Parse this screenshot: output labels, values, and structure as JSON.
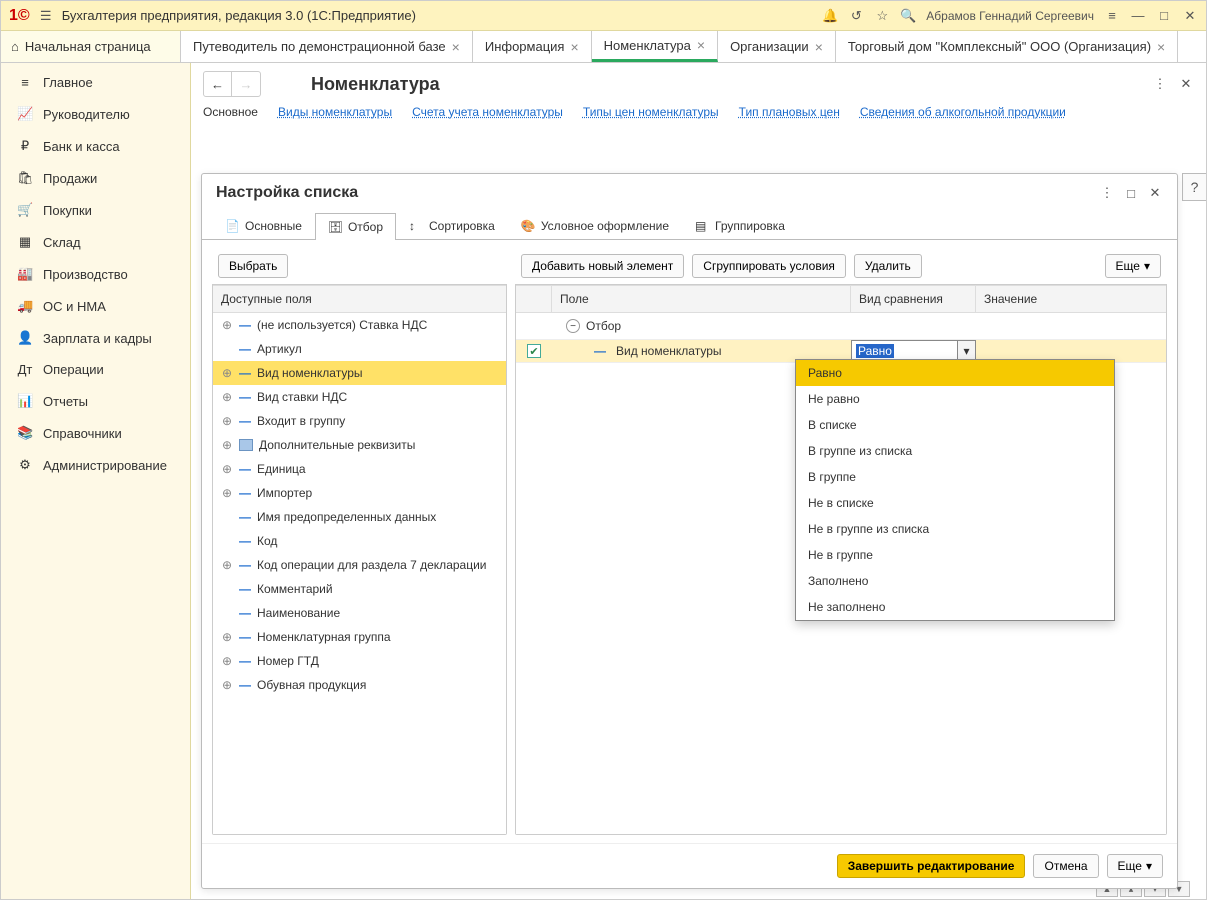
{
  "titlebar": {
    "app_title": "Бухгалтерия предприятия, редакция 3.0  (1С:Предприятие)",
    "user": "Абрамов Геннадий Сергеевич"
  },
  "tabs": {
    "home": "Начальная страница",
    "items": [
      {
        "label": "Путеводитель по демонстрационной базе",
        "active": false
      },
      {
        "label": "Информация",
        "active": false
      },
      {
        "label": "Номенклатура",
        "active": true
      },
      {
        "label": "Организации",
        "active": false
      },
      {
        "label": "Торговый дом \"Комплексный\" ООО (Организация)",
        "active": false
      }
    ]
  },
  "sidebar": {
    "items": [
      {
        "icon": "≡",
        "label": "Главное"
      },
      {
        "icon": "📈",
        "label": "Руководителю"
      },
      {
        "icon": "₽",
        "label": "Банк и касса"
      },
      {
        "icon": "🛍",
        "label": "Продажи"
      },
      {
        "icon": "🛒",
        "label": "Покупки"
      },
      {
        "icon": "▦",
        "label": "Склад"
      },
      {
        "icon": "🏭",
        "label": "Производство"
      },
      {
        "icon": "🚚",
        "label": "ОС и НМА"
      },
      {
        "icon": "👤",
        "label": "Зарплата и кадры"
      },
      {
        "icon": "Дт",
        "label": "Операции"
      },
      {
        "icon": "📊",
        "label": "Отчеты"
      },
      {
        "icon": "📚",
        "label": "Справочники"
      },
      {
        "icon": "⚙",
        "label": "Администрирование"
      }
    ]
  },
  "page": {
    "title": "Номенклатура",
    "subnav": [
      {
        "label": "Основное",
        "link": false
      },
      {
        "label": "Виды номенклатуры",
        "link": true
      },
      {
        "label": "Счета учета номенклатуры",
        "link": true
      },
      {
        "label": "Типы цен номенклатуры",
        "link": true
      },
      {
        "label": "Тип плановых цен",
        "link": true
      },
      {
        "label": "Сведения об алкогольной продукции",
        "link": true
      }
    ]
  },
  "dialog": {
    "title": "Настройка списка",
    "tabs": [
      {
        "label": "Основные",
        "active": false
      },
      {
        "label": "Отбор",
        "active": true
      },
      {
        "label": "Сортировка",
        "active": false
      },
      {
        "label": "Условное оформление",
        "active": false
      },
      {
        "label": "Группировка",
        "active": false
      }
    ],
    "left": {
      "select_btn": "Выбрать",
      "header": "Доступные поля",
      "rows": [
        {
          "exp": "+",
          "label": "(не используется) Ставка НДС"
        },
        {
          "exp": "",
          "label": "Артикул"
        },
        {
          "exp": "+",
          "label": "Вид номенклатуры",
          "selected": true
        },
        {
          "exp": "+",
          "label": "Вид ставки НДС"
        },
        {
          "exp": "+",
          "label": "Входит в группу"
        },
        {
          "exp": "+",
          "label": "Дополнительные реквизиты",
          "box": true
        },
        {
          "exp": "+",
          "label": "Единица"
        },
        {
          "exp": "+",
          "label": "Импортер"
        },
        {
          "exp": "",
          "label": "Имя предопределенных данных"
        },
        {
          "exp": "",
          "label": "Код"
        },
        {
          "exp": "+",
          "label": "Код операции для раздела 7 декларации"
        },
        {
          "exp": "",
          "label": "Комментарий"
        },
        {
          "exp": "",
          "label": "Наименование"
        },
        {
          "exp": "+",
          "label": "Номенклатурная группа"
        },
        {
          "exp": "+",
          "label": "Номер ГТД"
        },
        {
          "exp": "+",
          "label": "Обувная продукция"
        }
      ]
    },
    "right": {
      "btn_add": "Добавить новый элемент",
      "btn_group": "Сгруппировать условия",
      "btn_delete": "Удалить",
      "btn_more": "Еще",
      "headers": {
        "field": "Поле",
        "comparison": "Вид сравнения",
        "value": "Значение"
      },
      "root": "Отбор",
      "row": {
        "field": "Вид номенклатуры",
        "comparison": "Равно"
      },
      "dropdown": [
        "Равно",
        "Не равно",
        "В списке",
        "В группе из списка",
        "В группе",
        "Не в списке",
        "Не в группе из списка",
        "Не в группе",
        "Заполнено",
        "Не заполнено"
      ]
    },
    "footer": {
      "finish": "Завершить редактирование",
      "cancel": "Отмена",
      "more": "Еще"
    }
  }
}
